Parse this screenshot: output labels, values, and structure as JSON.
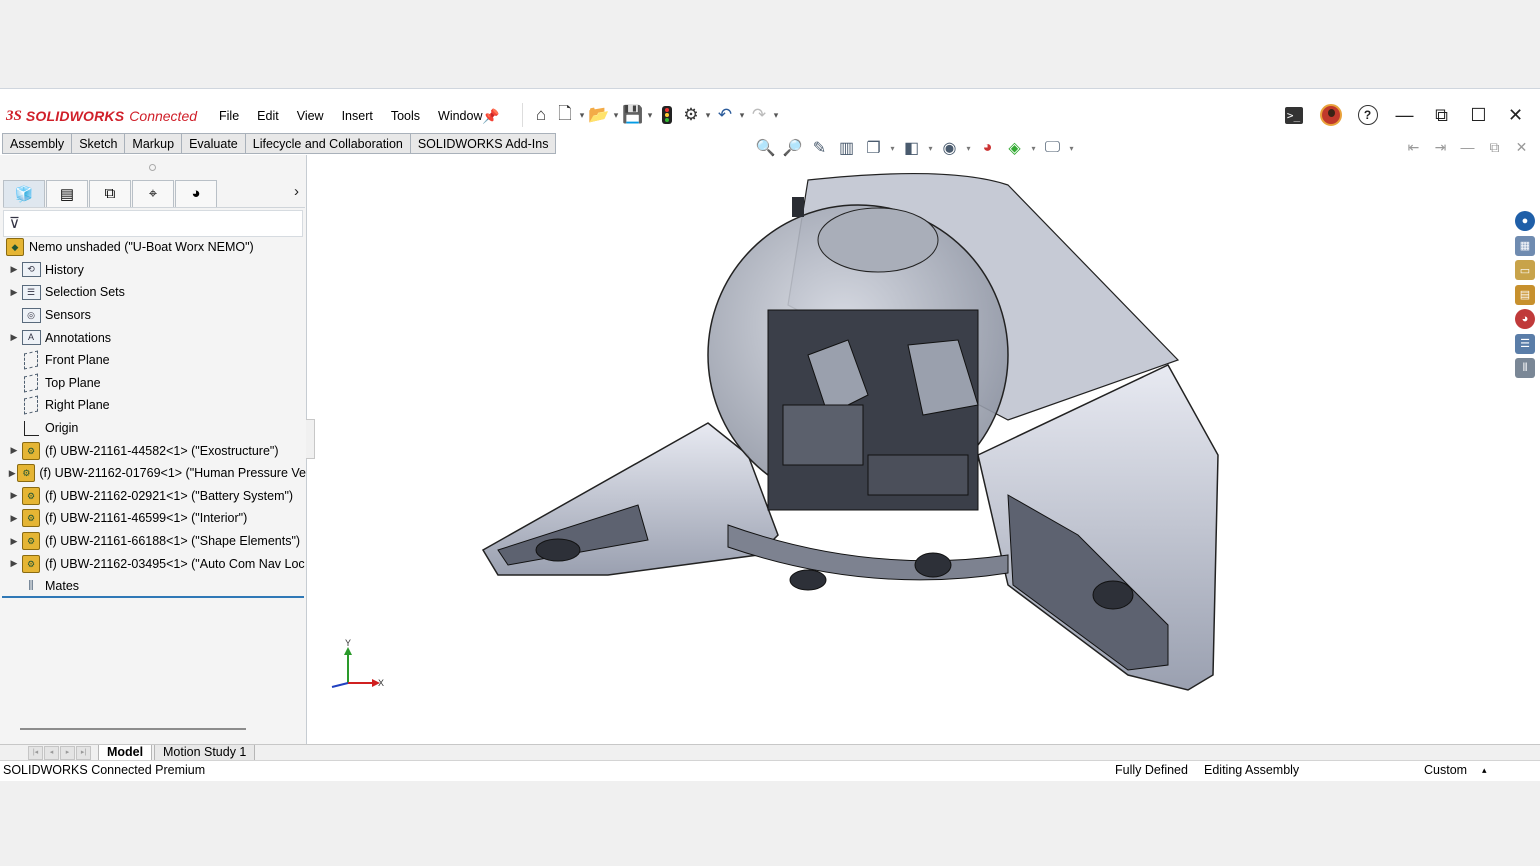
{
  "titlebar": {
    "logo_ds": "3S",
    "brand": "SOLIDWORKS",
    "brand_suffix": "Connected",
    "menu": [
      "File",
      "Edit",
      "View",
      "Insert",
      "Tools",
      "Window"
    ]
  },
  "tabs": [
    "Assembly",
    "Sketch",
    "Markup",
    "Evaluate",
    "Lifecycle and Collaboration",
    "SOLIDWORKS Add-Ins"
  ],
  "feature_tree": {
    "root": "Nemo unshaded (\"U-Boat Worx NEMO\")",
    "items": [
      {
        "label": "History",
        "icon": "history-folder-icon",
        "expandable": true
      },
      {
        "label": "Selection Sets",
        "icon": "selection-sets-icon",
        "expandable": true
      },
      {
        "label": "Sensors",
        "icon": "sensors-icon",
        "expandable": false
      },
      {
        "label": "Annotations",
        "icon": "annotations-icon",
        "expandable": true
      },
      {
        "label": "Front Plane",
        "icon": "plane-icon",
        "expandable": false
      },
      {
        "label": "Top Plane",
        "icon": "plane-icon",
        "expandable": false
      },
      {
        "label": "Right Plane",
        "icon": "plane-icon",
        "expandable": false
      },
      {
        "label": "Origin",
        "icon": "origin-icon",
        "expandable": false
      },
      {
        "label": "(f) UBW-21161-44582<1> (\"Exostructure\")",
        "icon": "subassembly-icon",
        "expandable": true
      },
      {
        "label": "(f) UBW-21162-01769<1> (\"Human Pressure Ve",
        "icon": "subassembly-icon",
        "expandable": true
      },
      {
        "label": "(f) UBW-21162-02921<1> (\"Battery System\")",
        "icon": "subassembly-icon",
        "expandable": true
      },
      {
        "label": "(f) UBW-21161-46599<1> (\"Interior\")",
        "icon": "subassembly-icon",
        "expandable": true
      },
      {
        "label": "(f) UBW-21161-66188<1> (\"Shape Elements\")",
        "icon": "subassembly-icon",
        "expandable": true
      },
      {
        "label": "(f) UBW-21162-03495<1> (\"Auto Com Nav Loc",
        "icon": "subassembly-icon",
        "expandable": true
      },
      {
        "label": "Mates",
        "icon": "mates-icon",
        "expandable": false
      }
    ]
  },
  "bottom_tabs": [
    "Model",
    "Motion Study 1"
  ],
  "status": {
    "product": "SOLIDWORKS Connected Premium",
    "definition": "Fully Defined",
    "mode": "Editing Assembly",
    "units": "Custom"
  },
  "triad": {
    "y": "Y",
    "x": "X"
  },
  "colors": {
    "brand_red": "#d0202a",
    "selection_blue": "#2f78b6",
    "axis_x": "#d02020",
    "axis_y": "#2a9a2a",
    "axis_z": "#2040c0"
  }
}
